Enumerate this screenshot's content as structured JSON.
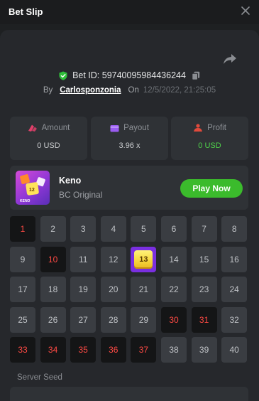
{
  "header": {
    "title": "Bet Slip"
  },
  "bet": {
    "id_label": "Bet ID: 59740095984436244",
    "by_label": "By",
    "user": "Carlosponzonia",
    "on_label": "On",
    "timestamp": "12/5/2022, 21:25:05"
  },
  "stats": [
    {
      "label": "Amount",
      "value": "0 USD",
      "icon": "coin-icon",
      "color": "#e0406a"
    },
    {
      "label": "Payout",
      "value": "3.96 x",
      "icon": "wallet-icon",
      "color": "#9a5cf0"
    },
    {
      "label": "Profit",
      "value": "0 USD",
      "icon": "profit-icon",
      "color": "#e04a3c"
    }
  ],
  "game": {
    "name": "Keno",
    "subtitle": "BC Original",
    "play_label": "Play Now",
    "thumb_number": "12",
    "thumb_caption": "KENO"
  },
  "grid": {
    "numbers": [
      "1",
      "2",
      "3",
      "4",
      "5",
      "6",
      "7",
      "8",
      "9",
      "10",
      "11",
      "12",
      "13",
      "14",
      "15",
      "16",
      "17",
      "18",
      "19",
      "20",
      "21",
      "22",
      "23",
      "24",
      "25",
      "26",
      "27",
      "28",
      "29",
      "30",
      "31",
      "32",
      "33",
      "34",
      "35",
      "36",
      "37",
      "38",
      "39",
      "40"
    ],
    "picked_miss": [
      1,
      10,
      30,
      31,
      33,
      34,
      35,
      36,
      37
    ],
    "picked_hit": [
      13
    ]
  },
  "seed": {
    "label": "Server Seed"
  },
  "colors": {
    "accent_green": "#3bbb2c",
    "hit_purple": "#7a2fe0",
    "miss_red": "#ff4a44"
  }
}
